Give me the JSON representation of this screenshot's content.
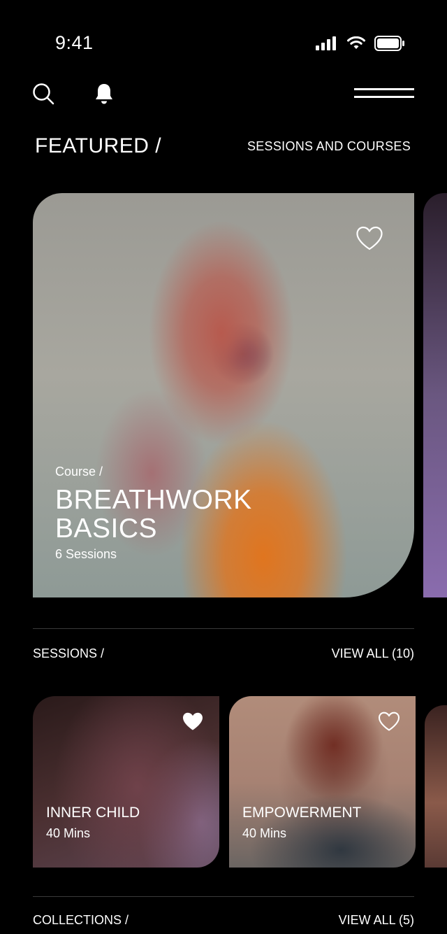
{
  "status_bar": {
    "time": "9:41"
  },
  "nav": {
    "search_icon": "search-icon",
    "bell_icon": "bell-icon",
    "menu_icon": "menu-icon"
  },
  "featured": {
    "title": "FEATURED /",
    "link_label": "SESSIONS AND COURSES",
    "card": {
      "type": "Course /",
      "title": "BREATHWORK BASICS",
      "meta": "6 Sessions",
      "favorited": false
    }
  },
  "sessions": {
    "title": "SESSIONS /",
    "link_label": "VIEW ALL (10)",
    "items": [
      {
        "title": "INNER CHILD",
        "meta": "40 Mins",
        "favorited": true
      },
      {
        "title": "EMPOWERMENT",
        "meta": "40 Mins",
        "favorited": false
      }
    ]
  },
  "collections": {
    "title": "COLLECTIONS /",
    "link_label": "VIEW ALL (5)"
  },
  "colors": {
    "background": "#000000",
    "text": "#ffffff",
    "divider": "#3a3a3a"
  }
}
